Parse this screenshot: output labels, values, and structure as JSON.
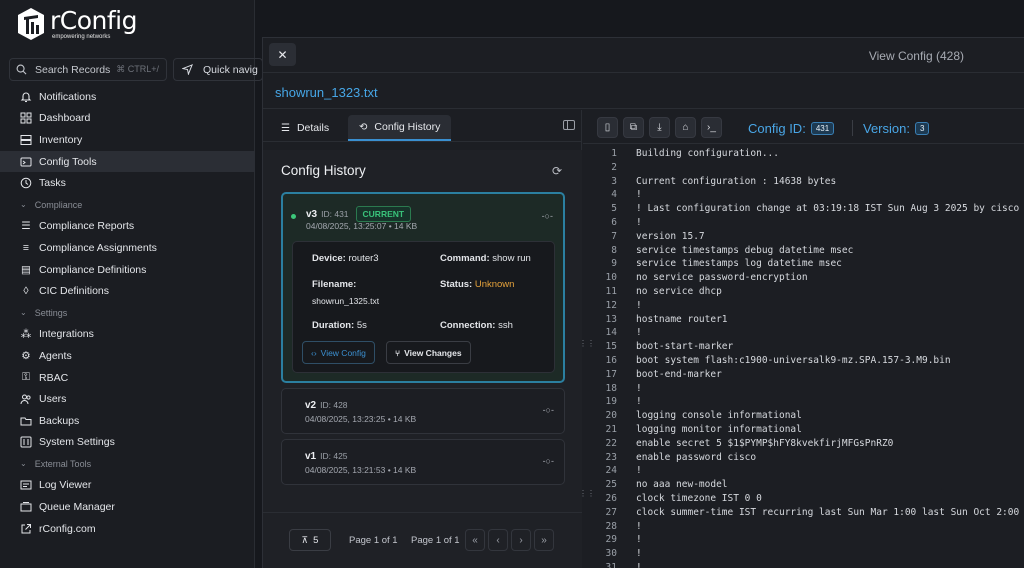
{
  "app": {
    "name": "rConfig",
    "tagline": "empowering networks"
  },
  "search": {
    "label": "Search Records",
    "shortcut": "⌘ CTRL+/",
    "quick_nav": "Quick navig"
  },
  "sidebar": {
    "top_items": [
      {
        "label": "Notifications",
        "icon": "bell-icon"
      },
      {
        "label": "Dashboard",
        "icon": "grid-icon"
      },
      {
        "label": "Inventory",
        "icon": "server-icon"
      },
      {
        "label": "Config Tools",
        "icon": "wrench-icon"
      },
      {
        "label": "Tasks",
        "icon": "clock-icon"
      }
    ],
    "sections": [
      {
        "title": "Compliance",
        "items": [
          "Compliance Reports",
          "Compliance Assignments",
          "Compliance Definitions",
          "CIC Definitions"
        ]
      },
      {
        "title": "Settings",
        "items": [
          "Integrations",
          "Agents",
          "RBAC",
          "Users",
          "Backups",
          "System Settings"
        ]
      },
      {
        "title": "External Tools",
        "items": [
          "Log Viewer",
          "Queue Manager",
          "rConfig.com"
        ]
      }
    ]
  },
  "drawer": {
    "title": "View Config (428)",
    "file_name": "showrun_1323.txt",
    "tabs": {
      "details": "Details",
      "history": "Config History"
    }
  },
  "history": {
    "title": "Config History",
    "versions": [
      {
        "version": "v3",
        "id_label": "ID: 431",
        "badge": "CURRENT",
        "meta": "04/08/2025, 13:25:07 • 14 KB",
        "device_label": "Device:",
        "device": "router3",
        "command_label": "Command:",
        "command": "show run",
        "filename_label": "Filename:",
        "filename": "showrun_1325.txt",
        "status_label": "Status:",
        "status": "Unknown",
        "duration_label": "Duration:",
        "duration": "5s",
        "connection_label": "Connection:",
        "connection": "ssh",
        "view_config": "View Config",
        "view_changes": "View Changes"
      },
      {
        "version": "v2",
        "id_label": "ID: 428",
        "meta": "04/08/2025, 13:23:25 • 14 KB"
      },
      {
        "version": "v1",
        "id_label": "ID: 425",
        "meta": "04/08/2025, 13:21:53 • 14 KB"
      }
    ],
    "pager": {
      "count": "5",
      "page_a": "Page 1 of 1",
      "page_b": "Page 1 of 1",
      "first": "«",
      "prev": "‹",
      "next": "›",
      "last": "»"
    }
  },
  "viewer": {
    "config_id_label": "Config ID:",
    "config_id": "431",
    "version_label": "Version:",
    "version": "3",
    "lines": [
      "Building configuration...",
      "",
      "Current configuration : 14638 bytes",
      "!",
      "! Last configuration change at 03:19:18 IST Sun Aug 3 2025 by cisco",
      "!",
      "version 15.7",
      "service timestamps debug datetime msec",
      "service timestamps log datetime msec",
      "no service password-encryption",
      "no service dhcp",
      "!",
      "hostname router1",
      "!",
      "boot-start-marker",
      "boot system flash:c1900-universalk9-mz.SPA.157-3.M9.bin",
      "boot-end-marker",
      "!",
      "!",
      "logging console informational",
      "logging monitor informational",
      "enable secret 5 $1$PYMP$hFY8kvekfirjMFGsPnRZ0",
      "enable password cisco",
      "!",
      "no aaa new-model",
      "clock timezone IST 0 0",
      "clock summer-time IST recurring last Sun Mar 1:00 last Sun Oct 2:00",
      "!",
      "!",
      "!",
      "!"
    ]
  },
  "colors": {
    "accent": "#46a6e6",
    "current_green": "#39c27a",
    "warning": "#e5a23b",
    "background": "#16181d"
  }
}
